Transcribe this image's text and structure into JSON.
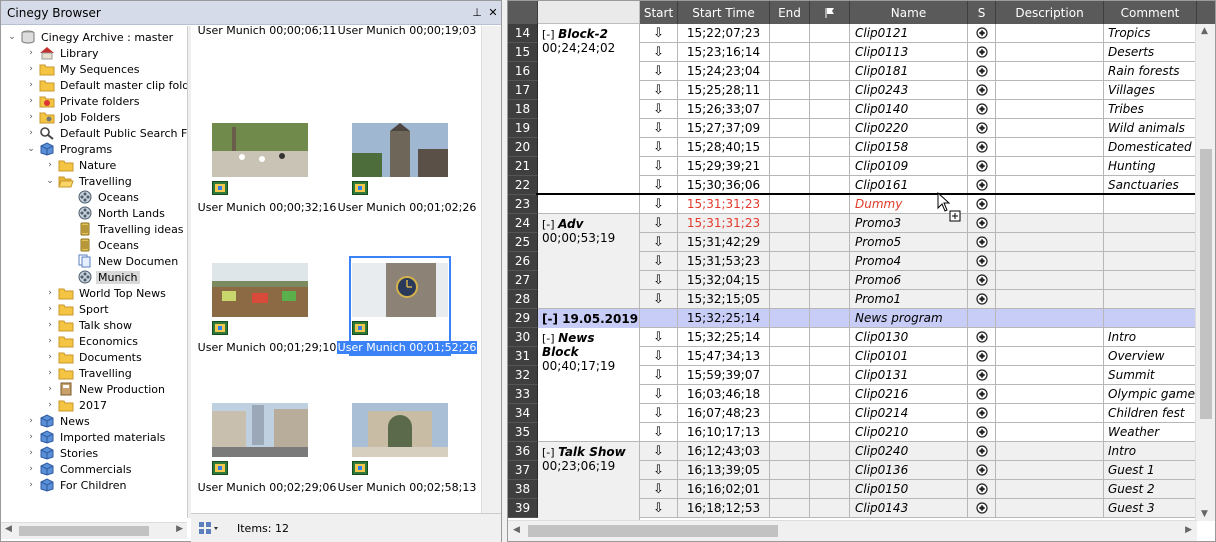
{
  "browser": {
    "title": "Cinegy Browser",
    "pin_glyph": "⊥",
    "close_glyph": "✕",
    "tree": [
      {
        "label": "Cinegy Archive : master",
        "depth": 0,
        "arrow": "open",
        "icon": "db"
      },
      {
        "label": "Library",
        "depth": 1,
        "arrow": "closed",
        "icon": "house"
      },
      {
        "label": "My Sequences",
        "depth": 1,
        "arrow": "closed",
        "icon": "folder"
      },
      {
        "label": "Default master clip folder",
        "depth": 1,
        "arrow": "closed",
        "icon": "folder"
      },
      {
        "label": "Private folders",
        "depth": 1,
        "arrow": "closed",
        "icon": "folder-color"
      },
      {
        "label": "Job Folders",
        "depth": 1,
        "arrow": "closed",
        "icon": "folder-gear"
      },
      {
        "label": "Default Public Search Fo",
        "depth": 1,
        "arrow": "closed",
        "icon": "search"
      },
      {
        "label": "Programs",
        "depth": 1,
        "arrow": "open",
        "icon": "cube"
      },
      {
        "label": "Nature",
        "depth": 2,
        "arrow": "closed",
        "icon": "folder"
      },
      {
        "label": "Travelling",
        "depth": 2,
        "arrow": "open",
        "icon": "folder-open"
      },
      {
        "label": "Oceans",
        "depth": 3,
        "arrow": "none",
        "icon": "reel"
      },
      {
        "label": "North Lands",
        "depth": 3,
        "arrow": "none",
        "icon": "reel"
      },
      {
        "label": "Travelling ideas",
        "depth": 3,
        "arrow": "none",
        "icon": "bin"
      },
      {
        "label": "Oceans",
        "depth": 3,
        "arrow": "none",
        "icon": "bin"
      },
      {
        "label": "New Documen",
        "depth": 3,
        "arrow": "none",
        "icon": "doc"
      },
      {
        "label": "Munich",
        "depth": 3,
        "arrow": "none",
        "icon": "reel",
        "selected": true
      },
      {
        "label": "World Top News",
        "depth": 2,
        "arrow": "closed",
        "icon": "folder"
      },
      {
        "label": "Sport",
        "depth": 2,
        "arrow": "closed",
        "icon": "folder"
      },
      {
        "label": "Talk show",
        "depth": 2,
        "arrow": "closed",
        "icon": "folder"
      },
      {
        "label": "Economics",
        "depth": 2,
        "arrow": "closed",
        "icon": "folder"
      },
      {
        "label": "Documents",
        "depth": 2,
        "arrow": "closed",
        "icon": "folder"
      },
      {
        "label": "Travelling",
        "depth": 2,
        "arrow": "closed",
        "icon": "folder"
      },
      {
        "label": "New Production",
        "depth": 2,
        "arrow": "closed",
        "icon": "book"
      },
      {
        "label": "2017",
        "depth": 2,
        "arrow": "closed",
        "icon": "folder"
      },
      {
        "label": "News",
        "depth": 1,
        "arrow": "closed",
        "icon": "cube"
      },
      {
        "label": "Imported materials",
        "depth": 1,
        "arrow": "closed",
        "icon": "cube"
      },
      {
        "label": "Stories",
        "depth": 1,
        "arrow": "closed",
        "icon": "cube"
      },
      {
        "label": "Commercials",
        "depth": 1,
        "arrow": "closed",
        "icon": "cube"
      },
      {
        "label": "For Children",
        "depth": 1,
        "arrow": "closed",
        "icon": "cube"
      }
    ],
    "clips": [
      {
        "caption": "User Munich 00;00;06;11",
        "scene": "top",
        "partial": true
      },
      {
        "caption": "User Munich 00;00;19;03",
        "scene": "top",
        "partial": true
      },
      {
        "caption": "User Munich 00;00;32;16",
        "scene": "square"
      },
      {
        "caption": "User Munich 00;01;02;26",
        "scene": "church"
      },
      {
        "caption": "User Munich 00;01;29;10",
        "scene": "market"
      },
      {
        "caption": "User Munich 00;01;52;26",
        "scene": "clock",
        "selected": true
      },
      {
        "caption": "User Munich 00;02;29;06",
        "scene": "street"
      },
      {
        "caption": "User Munich 00;02;58;13",
        "scene": "gate"
      }
    ],
    "status": {
      "items_label": "Items: 12"
    }
  },
  "grid": {
    "columns": [
      {
        "key": "num",
        "label": "",
        "w": 30
      },
      {
        "key": "blk",
        "label": "",
        "w": 102,
        "light": true
      },
      {
        "key": "start",
        "label": "Start",
        "w": 38
      },
      {
        "key": "time",
        "label": "Start Time",
        "w": 92
      },
      {
        "key": "end",
        "label": "End",
        "w": 40
      },
      {
        "key": "flag",
        "label": "",
        "w": 40,
        "flag": true
      },
      {
        "key": "name",
        "label": "Name",
        "w": 118
      },
      {
        "key": "s",
        "label": "S",
        "w": 28
      },
      {
        "key": "desc",
        "label": "Description",
        "w": 108
      },
      {
        "key": "comment",
        "label": "Comment",
        "w": 93
      }
    ],
    "blocks": [
      {
        "title": "Block-2",
        "duration": "00;24;24;02",
        "first_row": 14,
        "rows": 10
      },
      {
        "title": "Adv",
        "duration": "00;00;53;19",
        "first_row": 24,
        "rows": 5
      },
      {
        "title": "News Block",
        "duration": "00;40;17;19",
        "first_row": 30,
        "rows": 6
      },
      {
        "title": "Talk Show",
        "duration": "00;23;06;19",
        "first_row": 36,
        "rows": 5
      }
    ],
    "rows": [
      {
        "n": "14",
        "time": "15;22;07;23",
        "name": "Clip0121",
        "comment": "Tropics"
      },
      {
        "n": "15",
        "time": "15;23;16;14",
        "name": "Clip0113",
        "comment": "Deserts"
      },
      {
        "n": "16",
        "time": "15;24;23;04",
        "name": "Clip0181",
        "comment": "Rain forests"
      },
      {
        "n": "17",
        "time": "15;25;28;11",
        "name": "Clip0243",
        "comment": "Villages"
      },
      {
        "n": "18",
        "time": "15;26;33;07",
        "name": "Clip0140",
        "comment": "Tribes"
      },
      {
        "n": "19",
        "time": "15;27;37;09",
        "name": "Clip0220",
        "comment": "Wild animals"
      },
      {
        "n": "20",
        "time": "15;28;40;15",
        "name": "Clip0158",
        "comment": "Domesticated a"
      },
      {
        "n": "21",
        "time": "15;29;39;21",
        "name": "Clip0109",
        "comment": "Hunting"
      },
      {
        "n": "22",
        "time": "15;30;36;06",
        "name": "Clip0161",
        "comment": "Sanctuaries"
      },
      {
        "n": "23",
        "time": "15;31;31;23",
        "name": "Dummy",
        "comment": "",
        "red": true
      },
      {
        "n": "24",
        "time": "15;31;31;23",
        "name": "Promo3",
        "comment": "",
        "red_time": true
      },
      {
        "n": "25",
        "time": "15;31;42;29",
        "name": "Promo5",
        "comment": ""
      },
      {
        "n": "26",
        "time": "15;31;53;23",
        "name": "Promo4",
        "comment": ""
      },
      {
        "n": "27",
        "time": "15;32;04;15",
        "name": "Promo6",
        "comment": ""
      },
      {
        "n": "28",
        "time": "15;32;15;05",
        "name": "Promo1",
        "comment": ""
      },
      {
        "n": "29",
        "time": "15;32;25;14",
        "name": "News program",
        "comment": "",
        "band": true,
        "band_label": "[-]  19.05.2019"
      },
      {
        "n": "30",
        "time": "15;32;25;14",
        "name": "Clip0130",
        "comment": "Intro"
      },
      {
        "n": "31",
        "time": "15;47;34;13",
        "name": "Clip0101",
        "comment": "Overview"
      },
      {
        "n": "32",
        "time": "15;59;39;07",
        "name": "Clip0131",
        "comment": "Summit"
      },
      {
        "n": "33",
        "time": "16;03;46;18",
        "name": "Clip0216",
        "comment": "Olympic games"
      },
      {
        "n": "34",
        "time": "16;07;48;23",
        "name": "Clip0214",
        "comment": "Children fest"
      },
      {
        "n": "35",
        "time": "16;10;17;13",
        "name": "Clip0210",
        "comment": "Weather"
      },
      {
        "n": "36",
        "time": "16;12;43;03",
        "name": "Clip0240",
        "comment": "Intro"
      },
      {
        "n": "37",
        "time": "16;13;39;05",
        "name": "Clip0136",
        "comment": "Guest 1"
      },
      {
        "n": "38",
        "time": "16;16;02;01",
        "name": "Clip0150",
        "comment": "Guest 2"
      },
      {
        "n": "39",
        "time": "16;18;12;53",
        "name": "Clip0143",
        "comment": "Guest 3"
      }
    ],
    "start_glyph": "⇩",
    "collapse_glyph": "[-]"
  },
  "colors": {
    "accent": "#3b82f6",
    "band": "#c7cdf6",
    "header": "#5a5a5a",
    "red": "#e23a2a"
  }
}
